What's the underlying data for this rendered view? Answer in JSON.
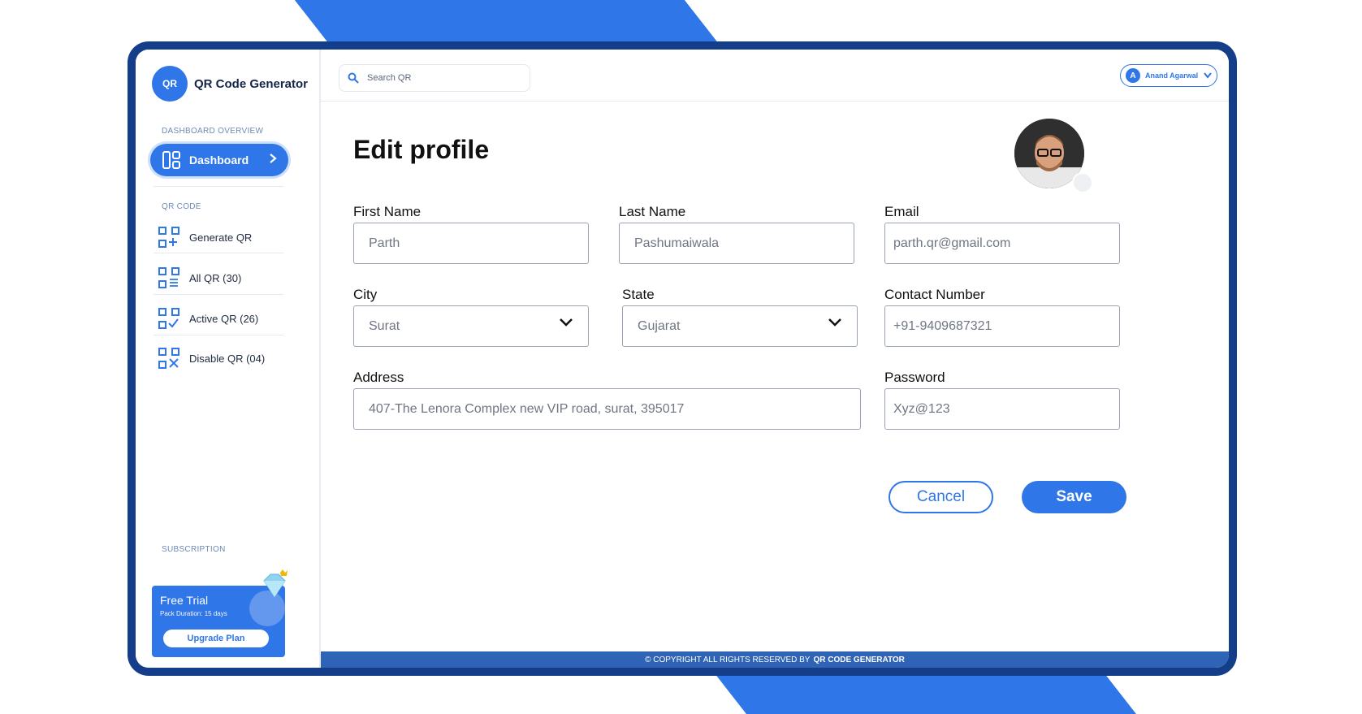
{
  "app": {
    "brand_name": "QR Code Generator",
    "brand_logo_text": "QR"
  },
  "sidebar": {
    "section_overview": "DASHBOARD OVERVIEW",
    "dashboard_label": "Dashboard",
    "section_qr": "QR CODE",
    "items": [
      {
        "label": "Generate QR",
        "icon": "qr-add-icon"
      },
      {
        "label": "All QR (30)",
        "icon": "qr-list-icon"
      },
      {
        "label": "Active QR (26)",
        "icon": "qr-check-icon"
      },
      {
        "label": "Disable QR (04)",
        "icon": "qr-disable-icon"
      }
    ],
    "section_subscription": "SUBSCRIPTION",
    "subscription": {
      "plan": "Free Trial",
      "duration": "Pack Duration: 15 days",
      "upgrade_label": "Upgrade Plan"
    }
  },
  "header": {
    "search_placeholder": "Search QR",
    "user": {
      "initial": "A",
      "name": "Anand Agarwal"
    }
  },
  "form": {
    "title": "Edit profile",
    "first_name": {
      "label": "First Name",
      "value": "Parth"
    },
    "last_name": {
      "label": "Last Name",
      "value": "Pashumaiwala"
    },
    "email": {
      "label": "Email",
      "value": "parth.qr@gmail.com"
    },
    "city": {
      "label": "City",
      "value": "Surat"
    },
    "state": {
      "label": "State",
      "value": "Gujarat"
    },
    "contact": {
      "label": "Contact Number",
      "value": "+91-9409687321"
    },
    "address": {
      "label": "Address",
      "value": "407-The Lenora Complex new VIP road, surat, 395017"
    },
    "password": {
      "label": "Password",
      "value": "Xyz@123"
    },
    "cancel_label": "Cancel",
    "save_label": "Save"
  },
  "footer": {
    "text": "© COPYRIGHT ALL RIGHTS RESERVED BY",
    "brand": "QR CODE GENERATOR"
  },
  "colors": {
    "accent": "#2f76e8",
    "frame": "#143e8a",
    "footer": "#2f63b6"
  }
}
